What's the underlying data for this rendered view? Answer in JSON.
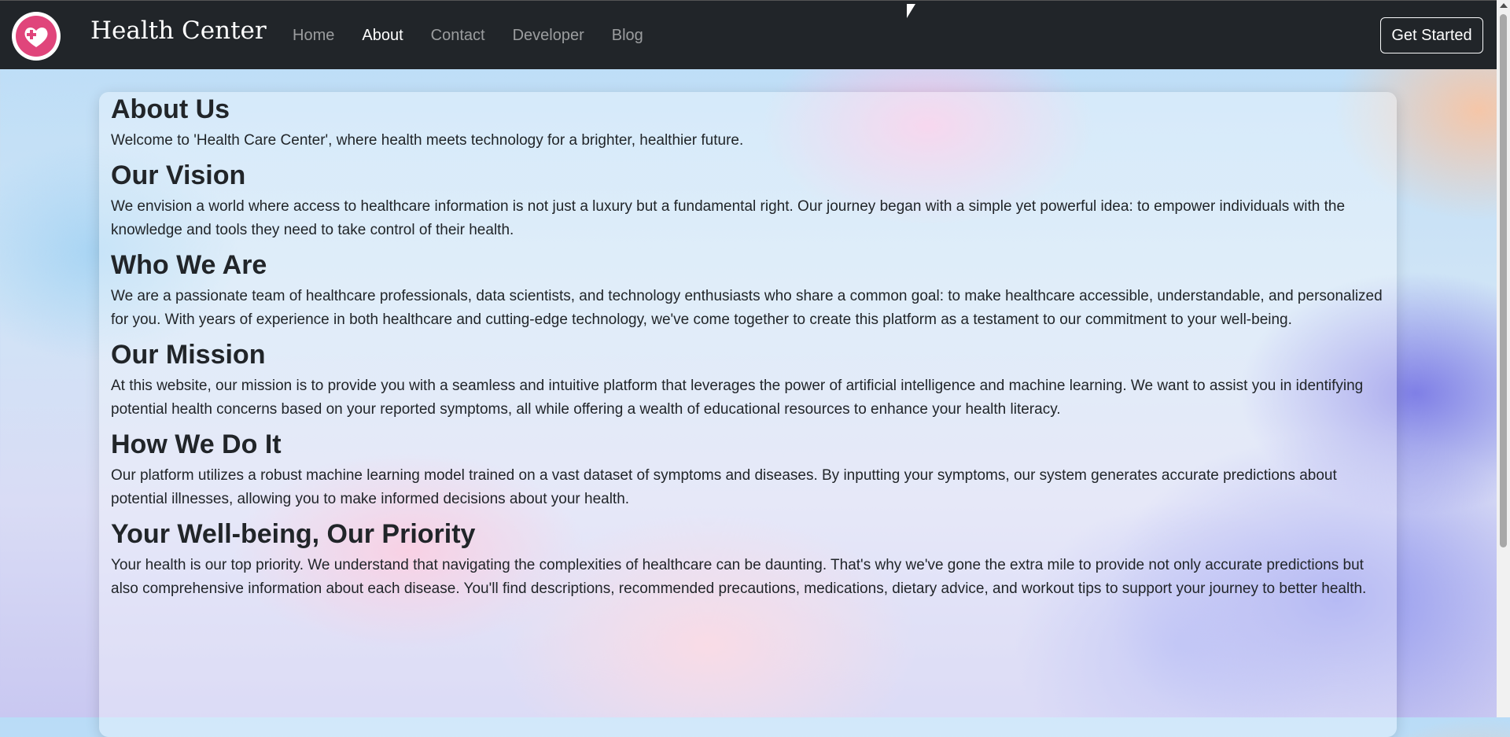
{
  "navbar": {
    "brand": "Health Center",
    "links": [
      {
        "label": "Home",
        "active": false
      },
      {
        "label": "About",
        "active": true
      },
      {
        "label": "Contact",
        "active": false
      },
      {
        "label": "Developer",
        "active": false
      },
      {
        "label": "Blog",
        "active": false
      }
    ],
    "cta_label": "Get Started"
  },
  "about": {
    "title": "About Us",
    "intro": "Welcome to 'Health Care Center', where health meets technology for a brighter, healthier future.",
    "sections": [
      {
        "heading": "Our Vision",
        "text": "We envision a world where access to healthcare information is not just a luxury but a fundamental right. Our journey began with a simple yet powerful idea: to empower individuals with the knowledge and tools they need to take control of their health."
      },
      {
        "heading": "Who We Are",
        "text": "We are a passionate team of healthcare professionals, data scientists, and technology enthusiasts who share a common goal: to make healthcare accessible, understandable, and personalized for you. With years of experience in both healthcare and cutting-edge technology, we've come together to create this platform as a testament to our commitment to your well-being."
      },
      {
        "heading": "Our Mission",
        "text": "At this website, our mission is to provide you with a seamless and intuitive platform that leverages the power of artificial intelligence and machine learning. We want to assist you in identifying potential health concerns based on your reported symptoms, all while offering a wealth of educational resources to enhance your health literacy."
      },
      {
        "heading": "How We Do It",
        "text": "Our platform utilizes a robust machine learning model trained on a vast dataset of symptoms and diseases. By inputting your symptoms, our system generates accurate predictions about potential illnesses, allowing you to make informed decisions about your health."
      },
      {
        "heading": "Your Well-being, Our Priority",
        "text": "Your health is our top priority. We understand that navigating the complexities of healthcare can be daunting. That's why we've gone the extra mile to provide not only accurate predictions but also comprehensive information about each disease. You'll find descriptions, recommended precautions, medications, dietary advice, and workout tips to support your journey to better health."
      }
    ]
  },
  "colors": {
    "navbar_bg": "#212529",
    "logo_accent": "#e0457b",
    "text": "#212529"
  },
  "icons": {
    "logo": "heart-medical-cross-icon",
    "cursor": "mouse-cursor-icon"
  }
}
